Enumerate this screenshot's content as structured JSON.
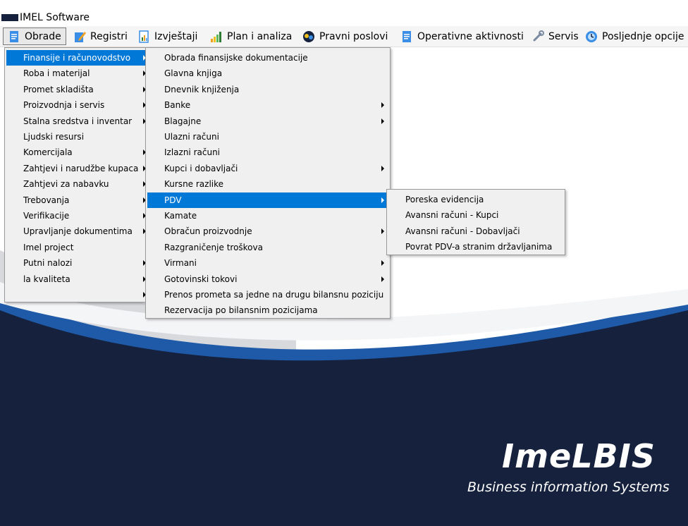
{
  "app": {
    "title": "IMEL Software"
  },
  "menubar": {
    "items": [
      {
        "label": "Obrade",
        "icon": "document-icon"
      },
      {
        "label": "Registri",
        "icon": "edit-icon"
      },
      {
        "label": "Izvještaji",
        "icon": "report-icon"
      },
      {
        "label": "Plan i analiza",
        "icon": "bar-chart-icon"
      },
      {
        "label": "Pravni poslovi",
        "icon": "legal-icon"
      },
      {
        "label": "Operativne aktivnosti",
        "icon": "document-icon"
      },
      {
        "label": "Servis",
        "icon": "wrench-icon"
      },
      {
        "label": "Posljednje opcije",
        "icon": "recent-icon"
      }
    ]
  },
  "menu1": {
    "items": [
      {
        "label": "Finansije i računovodstvo",
        "submenu": true,
        "selected": true
      },
      {
        "label": "Roba i materijal",
        "submenu": true
      },
      {
        "label": "Promet skladišta",
        "submenu": true
      },
      {
        "label": "Proizvodnja i servis",
        "submenu": true
      },
      {
        "label": "Stalna sredstva i inventar",
        "submenu": true
      },
      {
        "label": "Ljudski resursi",
        "submenu": false
      },
      {
        "label": "Komercijala",
        "submenu": true
      },
      {
        "label": "Zahtjevi i narudžbe kupaca",
        "submenu": true
      },
      {
        "label": "Zahtjevi za nabavku",
        "submenu": true
      },
      {
        "label": "Trebovanja",
        "submenu": true
      },
      {
        "label": "Verifikacije",
        "submenu": true
      },
      {
        "label": "Upravljanje dokumentima",
        "submenu": true
      },
      {
        "label": "Imel project",
        "submenu": false
      },
      {
        "label": "Putni nalozi",
        "submenu": true
      },
      {
        "label": "la kvaliteta",
        "submenu": true
      },
      {
        "label": "",
        "submenu": true
      }
    ]
  },
  "menu2": {
    "items": [
      {
        "label": "Obrada finansijske dokumentacije",
        "submenu": false
      },
      {
        "label": "Glavna knjiga",
        "submenu": false
      },
      {
        "label": "Dnevnik knjiženja",
        "submenu": false
      },
      {
        "label": "Banke",
        "submenu": true
      },
      {
        "label": "Blagajne",
        "submenu": true
      },
      {
        "label": "Ulazni računi",
        "submenu": false
      },
      {
        "label": "Izlazni računi",
        "submenu": false
      },
      {
        "label": "Kupci i dobavljači",
        "submenu": true
      },
      {
        "label": "Kursne razlike",
        "submenu": false
      },
      {
        "label": "PDV",
        "submenu": true,
        "selected": true
      },
      {
        "label": "Kamate",
        "submenu": false
      },
      {
        "label": "Obračun proizvodnje",
        "submenu": true
      },
      {
        "label": "Razgraničenje troškova",
        "submenu": false
      },
      {
        "label": "Virmani",
        "submenu": true
      },
      {
        "label": "Gotovinski tokovi",
        "submenu": true
      },
      {
        "label": "Prenos prometa sa jedne na drugu bilansnu poziciju",
        "submenu": false
      },
      {
        "label": "Rezervacija po bilansnim pozicijama",
        "submenu": false
      }
    ]
  },
  "menu3": {
    "items": [
      {
        "label": "Poreska evidencija"
      },
      {
        "label": "Avansni računi - Kupci"
      },
      {
        "label": "Avansni računi - Dobavljači"
      },
      {
        "label": "Povrat PDV-a stranim državljanima"
      }
    ]
  },
  "brand": {
    "name": "ImeLBIS",
    "tagline": "Business information Systems"
  },
  "colors": {
    "navy": "#15213d",
    "selection": "#0078d7",
    "wave_blue": "#1e5aa8"
  }
}
